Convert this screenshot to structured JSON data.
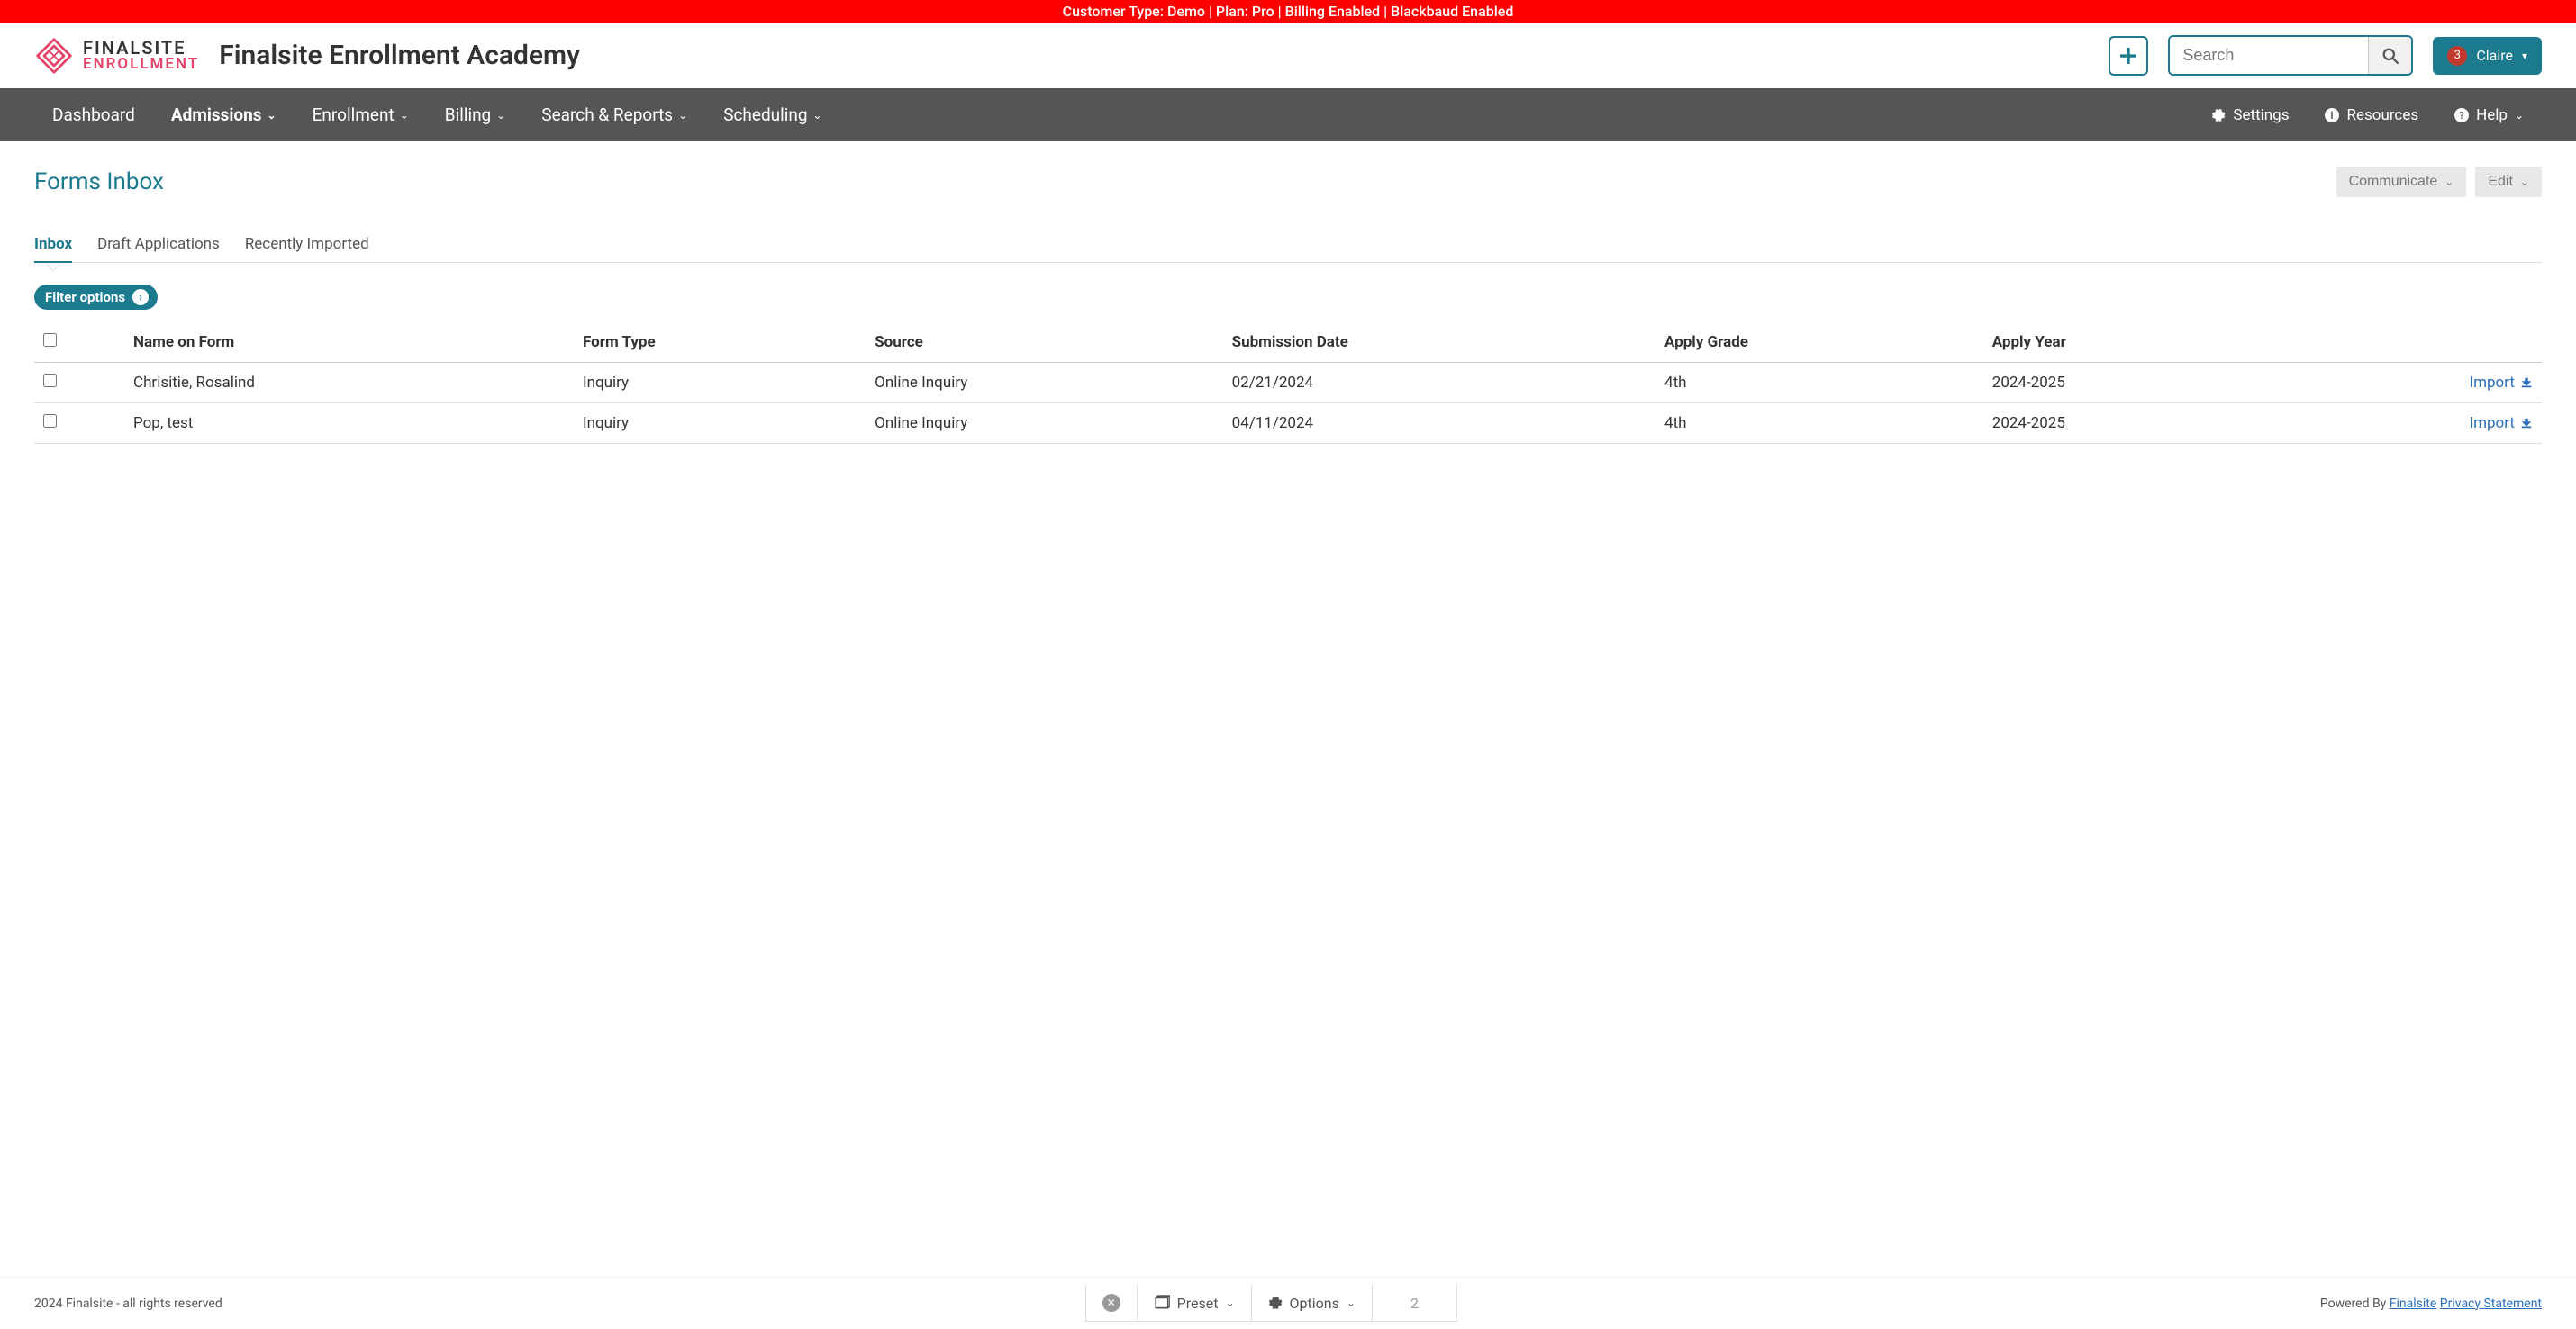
{
  "banner": "Customer Type: Demo | Plan: Pro | Billing Enabled | Blackbaud Enabled",
  "logo": {
    "line1": "FINALSITE",
    "line2": "ENROLLMENT"
  },
  "academy_title": "Finalsite Enrollment Academy",
  "search": {
    "placeholder": "Search"
  },
  "user": {
    "name": "Claire",
    "badge": "3"
  },
  "nav": {
    "items": [
      "Dashboard",
      "Admissions",
      "Enrollment",
      "Billing",
      "Search & Reports",
      "Scheduling"
    ],
    "active_index": 1,
    "right": {
      "settings": "Settings",
      "resources": "Resources",
      "help": "Help"
    }
  },
  "page": {
    "title": "Forms Inbox",
    "actions": {
      "communicate": "Communicate",
      "edit": "Edit"
    }
  },
  "tabs": {
    "items": [
      "Inbox",
      "Draft Applications",
      "Recently Imported"
    ],
    "active_index": 0
  },
  "filter": {
    "label": "Filter options"
  },
  "table": {
    "headers": [
      "Name on Form",
      "Form Type",
      "Source",
      "Submission Date",
      "Apply Grade",
      "Apply Year"
    ],
    "rows": [
      {
        "name": "Chrisitie, Rosalind",
        "form_type": "Inquiry",
        "source": "Online Inquiry",
        "submission_date": "02/21/2024",
        "apply_grade": "4th",
        "apply_year": "2024-2025",
        "action": "Import"
      },
      {
        "name": "Pop, test",
        "form_type": "Inquiry",
        "source": "Online Inquiry",
        "submission_date": "04/11/2024",
        "apply_grade": "4th",
        "apply_year": "2024-2025",
        "action": "Import"
      }
    ]
  },
  "footer": {
    "copyright": "2024 Finalsite - all rights reserved",
    "preset": "Preset",
    "options": "Options",
    "count": "2",
    "powered_prefix": "Powered By ",
    "powered_link1": "Finalsite",
    "powered_link2": "Privacy Statement"
  }
}
